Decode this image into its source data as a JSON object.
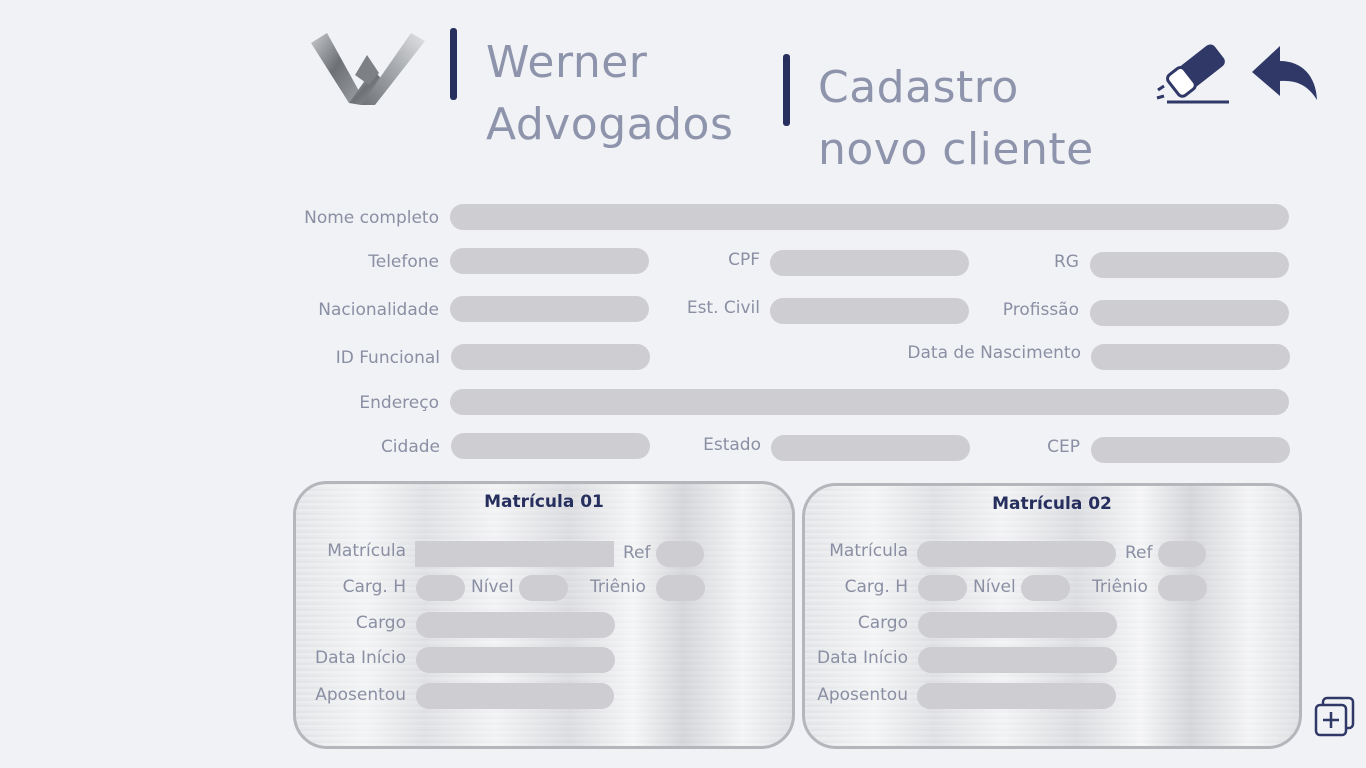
{
  "brand": {
    "line1": "Werner",
    "line2": "Advogados"
  },
  "header": {
    "title_line1": "Cadastro",
    "title_line2": "novo cliente"
  },
  "toolbar": {
    "clear_icon": "eraser-icon",
    "back_icon": "back-arrow-icon",
    "add_icon": "add-copy-icon"
  },
  "form": {
    "labels": {
      "nome": "Nome completo",
      "telefone": "Telefone",
      "cpf": "CPF",
      "rg": "RG",
      "nacionalidade": "Nacionalidade",
      "est_civil": "Est. Civil",
      "profissao": "Profissão",
      "id_funcional": "ID Funcional",
      "data_nascimento": "Data de Nascimento",
      "endereco": "Endereço",
      "cidade": "Cidade",
      "estado": "Estado",
      "cep": "CEP"
    }
  },
  "matriculas": [
    {
      "title": "Matrícula 01",
      "labels": {
        "matricula": "Matrícula",
        "ref": "Ref",
        "carg_h": "Carg. H",
        "nivel": "Nível",
        "trienio": "Triênio",
        "cargo": "Cargo",
        "data_inicio": "Data Início",
        "aposentou": "Aposentou"
      }
    },
    {
      "title": "Matrícula 02",
      "labels": {
        "matricula": "Matrícula",
        "ref": "Ref",
        "carg_h": "Carg. H",
        "nivel": "Nível",
        "trienio": "Triênio",
        "cargo": "Cargo",
        "data_inicio": "Data Início",
        "aposentou": "Aposentou"
      }
    }
  ],
  "colors": {
    "accent": "#272f5e",
    "field": "#cdcdd2",
    "label": "#8a8fa3",
    "background": "#f1f2f6"
  }
}
